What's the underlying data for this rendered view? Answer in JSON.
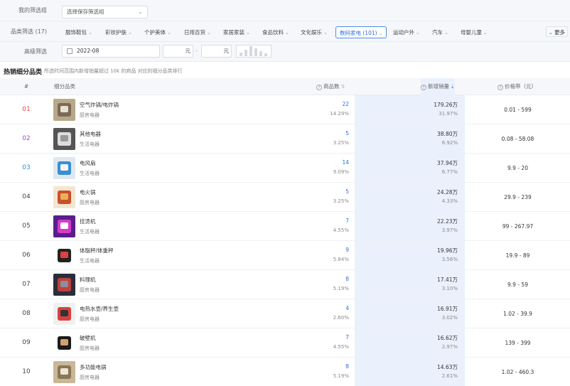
{
  "filters": {
    "saved_label": "我的筛选组",
    "saved_placeholder": "选择保存筛选组",
    "category_label": "品类筛选 (17)",
    "categories": [
      {
        "label": "服饰鞋包",
        "active": false
      },
      {
        "label": "彩妆护肤",
        "active": false
      },
      {
        "label": "个护美体",
        "active": false
      },
      {
        "label": "日用百货",
        "active": false
      },
      {
        "label": "家居家装",
        "active": false
      },
      {
        "label": "食品饮料",
        "active": false
      },
      {
        "label": "文化娱乐",
        "active": false
      },
      {
        "label": "数码家电 (101)",
        "active": true
      },
      {
        "label": "运动户外",
        "active": false
      },
      {
        "label": "汽车",
        "active": false
      },
      {
        "label": "母婴儿童",
        "active": false
      }
    ],
    "more_label": "更多",
    "advanced_label": "高级筛选",
    "date_value": "2022-08",
    "price_unit_1": "元",
    "price_unit_2": "元",
    "price_separator": "-",
    "histogram_levels": [
      0.3,
      0.55,
      0.9,
      0.7,
      0.45,
      0.25
    ]
  },
  "section": {
    "title": "热销细分品类",
    "description": "所选时间范围内新增销量超过 10k 的商品 对应的细分品类排行"
  },
  "table": {
    "headers": {
      "rank": "#",
      "category": "细分品类",
      "count": "商品数",
      "sales": "新增销量",
      "price": "价格带（元）"
    },
    "rank_colors": {
      "1": "#e8453c",
      "2": "#a44bd8",
      "3": "#2b8fd9",
      "default": "#444444"
    },
    "rows": [
      {
        "rank": "01",
        "name": "空气炸锅/电炸锅",
        "parent": "厨房电器",
        "count": "22",
        "count_pct": "14.29%",
        "sales": "179.26万",
        "sales_pct": "31.97%",
        "price": "0.01 - 599",
        "thumb": [
          "#b8a88a",
          "#7a6a55",
          "#e8e0d0"
        ]
      },
      {
        "rank": "02",
        "name": "其他电器",
        "parent": "生活电器",
        "count": "5",
        "count_pct": "3.25%",
        "sales": "38.80万",
        "sales_pct": "6.92%",
        "price": "0.08 - 58.08",
        "thumb": [
          "#555555",
          "#dddddd",
          "#999999"
        ]
      },
      {
        "rank": "03",
        "name": "电风扇",
        "parent": "生活电器",
        "count": "14",
        "count_pct": "9.09%",
        "sales": "37.94万",
        "sales_pct": "6.77%",
        "price": "9.9 - 20",
        "thumb": [
          "#dfe8f0",
          "#3a8fd0",
          "#f4f4f4"
        ]
      },
      {
        "rank": "04",
        "name": "电火锅",
        "parent": "厨房电器",
        "count": "5",
        "count_pct": "3.25%",
        "sales": "24.28万",
        "sales_pct": "4.33%",
        "price": "29.9 - 239",
        "thumb": [
          "#f3e6d0",
          "#c9502c",
          "#e9b05a"
        ]
      },
      {
        "rank": "05",
        "name": "挂烫机",
        "parent": "生活电器",
        "count": "7",
        "count_pct": "4.55%",
        "sales": "22.23万",
        "sales_pct": "3.97%",
        "price": "99 - 267.97",
        "thumb": [
          "#5a1e8c",
          "#d63cc8",
          "#ffffff"
        ]
      },
      {
        "rank": "06",
        "name": "体脂秤/体重秤",
        "parent": "生活电器",
        "count": "9",
        "count_pct": "5.84%",
        "sales": "19.96万",
        "sales_pct": "3.56%",
        "price": "19.9 - 89",
        "thumb": [
          "#ffffff",
          "#222222",
          "#e04040"
        ]
      },
      {
        "rank": "07",
        "name": "料理机",
        "parent": "厨房电器",
        "count": "8",
        "count_pct": "5.19%",
        "sales": "17.41万",
        "sales_pct": "3.10%",
        "price": "9.9 - 59",
        "thumb": [
          "#2a2e3a",
          "#c04040",
          "#8a8f9a"
        ]
      },
      {
        "rank": "08",
        "name": "电热水壶/养生壶",
        "parent": "厨房电器",
        "count": "4",
        "count_pct": "2.60%",
        "sales": "16.91万",
        "sales_pct": "3.02%",
        "price": "1.02 - 39.9",
        "thumb": [
          "#f0f0f0",
          "#d84040",
          "#333333"
        ]
      },
      {
        "rank": "09",
        "name": "破壁机",
        "parent": "厨房电器",
        "count": "7",
        "count_pct": "4.55%",
        "sales": "16.62万",
        "sales_pct": "2.97%",
        "price": "139 - 399",
        "thumb": [
          "#ffffff",
          "#1a1a1a",
          "#d0a070"
        ]
      },
      {
        "rank": "10",
        "name": "多功能电锅",
        "parent": "厨房电器",
        "count": "8",
        "count_pct": "5.19%",
        "sales": "14.63万",
        "sales_pct": "2.61%",
        "price": "1.02 - 460.3",
        "thumb": [
          "#c8b898",
          "#8a7558",
          "#eee4d2"
        ]
      }
    ]
  }
}
